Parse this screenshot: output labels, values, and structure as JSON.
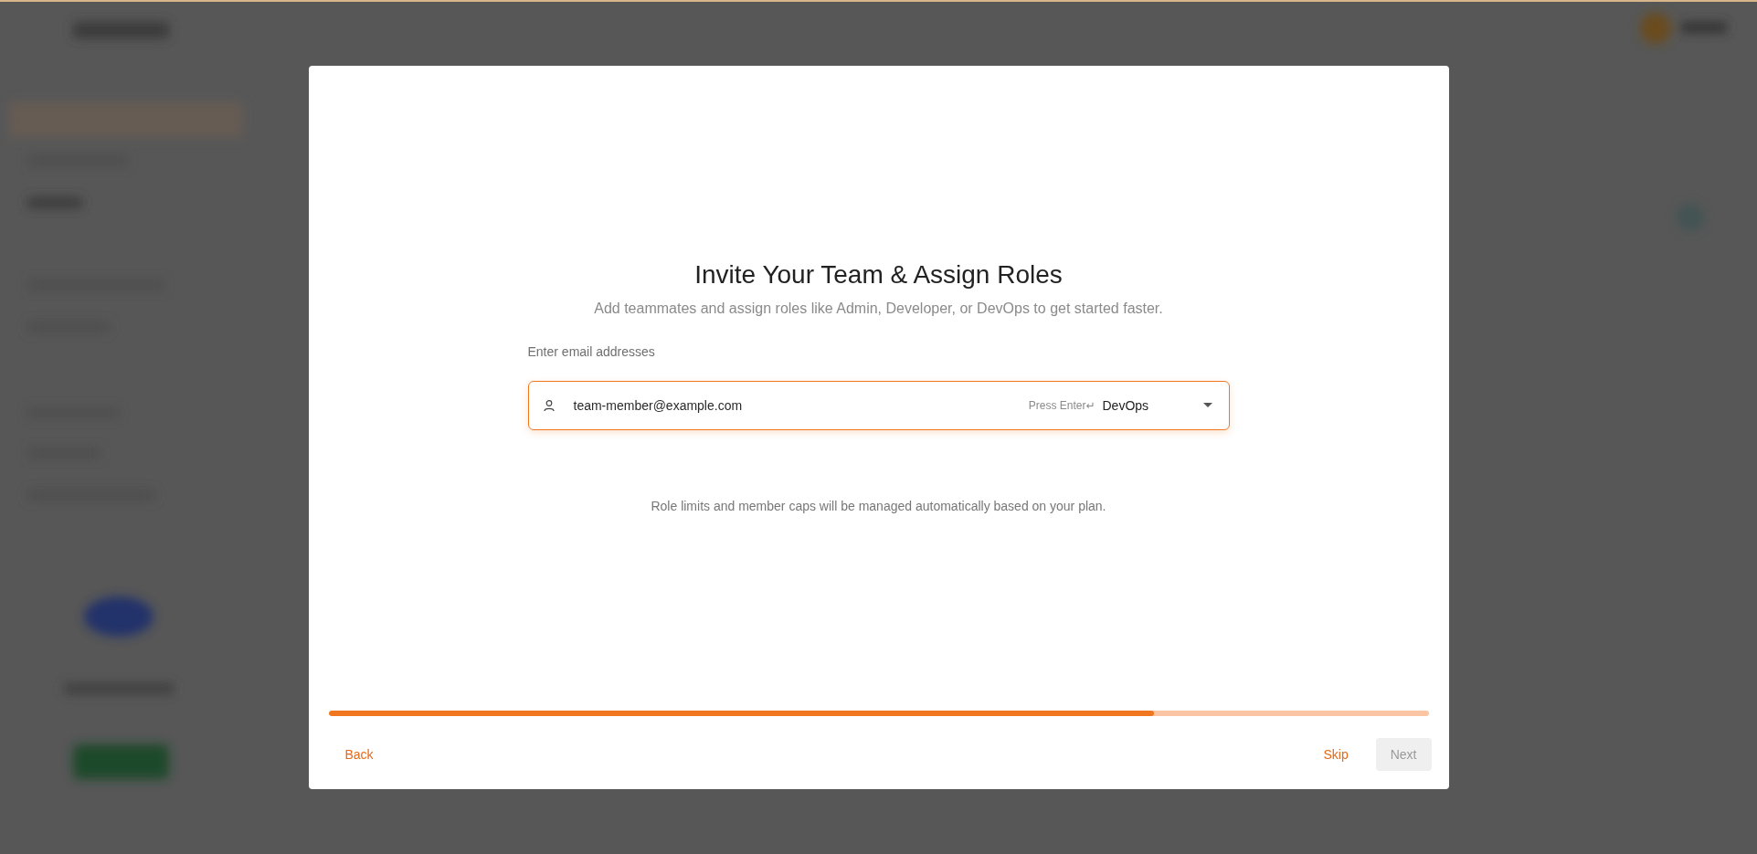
{
  "dialog": {
    "title": "Invite Your Team & Assign Roles",
    "subtitle": "Add teammates and assign roles like Admin, Developer, or DevOps to get started faster.",
    "email_field": {
      "label": "Enter email addresses",
      "value": "team-member@example.com",
      "hint": "Press Enter↵",
      "role": "DevOps"
    },
    "note": "Role limits and member caps will be managed automatically based on your plan.",
    "progress": {
      "level": 0.75
    },
    "back": "Back",
    "skip": "Skip",
    "next": {
      "label": "Next",
      "disabled": true
    }
  }
}
